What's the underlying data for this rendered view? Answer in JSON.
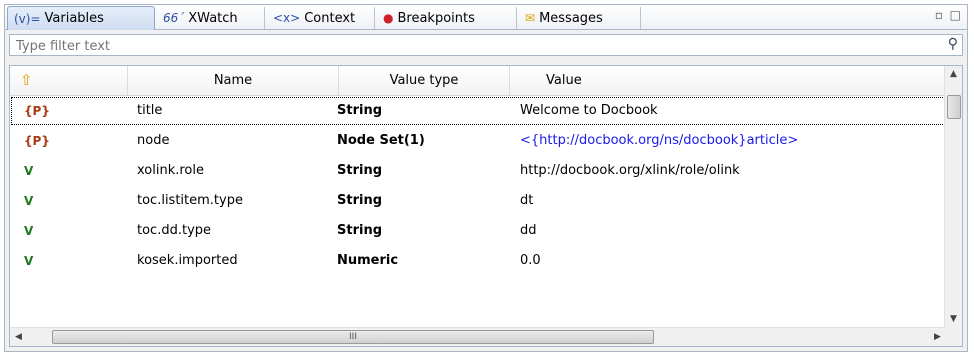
{
  "tabs": [
    {
      "icon": "(v)=",
      "label": "Variables",
      "active": true
    },
    {
      "icon": "66´",
      "label": "XWatch"
    },
    {
      "icon": "<x>",
      "label": "Context"
    },
    {
      "icon": "●",
      "label": "Breakpoints"
    },
    {
      "icon": "✉",
      "label": "Messages"
    }
  ],
  "filter": {
    "placeholder": "Type filter text"
  },
  "columns": {
    "sort": "⇧",
    "name": "Name",
    "value_type": "Value type",
    "value": "Value"
  },
  "rows": [
    {
      "kind": "{P}",
      "name": "title",
      "type": "String",
      "value": "Welcome to Docbook"
    },
    {
      "kind": "{P}",
      "name": "node",
      "type": "Node Set(1)",
      "value": "<{http://docbook.org/ns/docbook}article>"
    },
    {
      "kind": "V",
      "name": "xolink.role",
      "type": "String",
      "value": "http://docbook.org/xlink/role/olink"
    },
    {
      "kind": "V",
      "name": "toc.listitem.type",
      "type": "String",
      "value": "dt"
    },
    {
      "kind": "V",
      "name": "toc.dd.type",
      "type": "String",
      "value": "dd"
    },
    {
      "kind": "V",
      "name": "kosek.imported",
      "type": "Numeric",
      "value": "0.0"
    }
  ],
  "scroll": {
    "thumb_grip": "III"
  },
  "colors": {
    "param": "#a83a14",
    "variable": "#1f7a1f",
    "link": "#1a1ae6"
  }
}
